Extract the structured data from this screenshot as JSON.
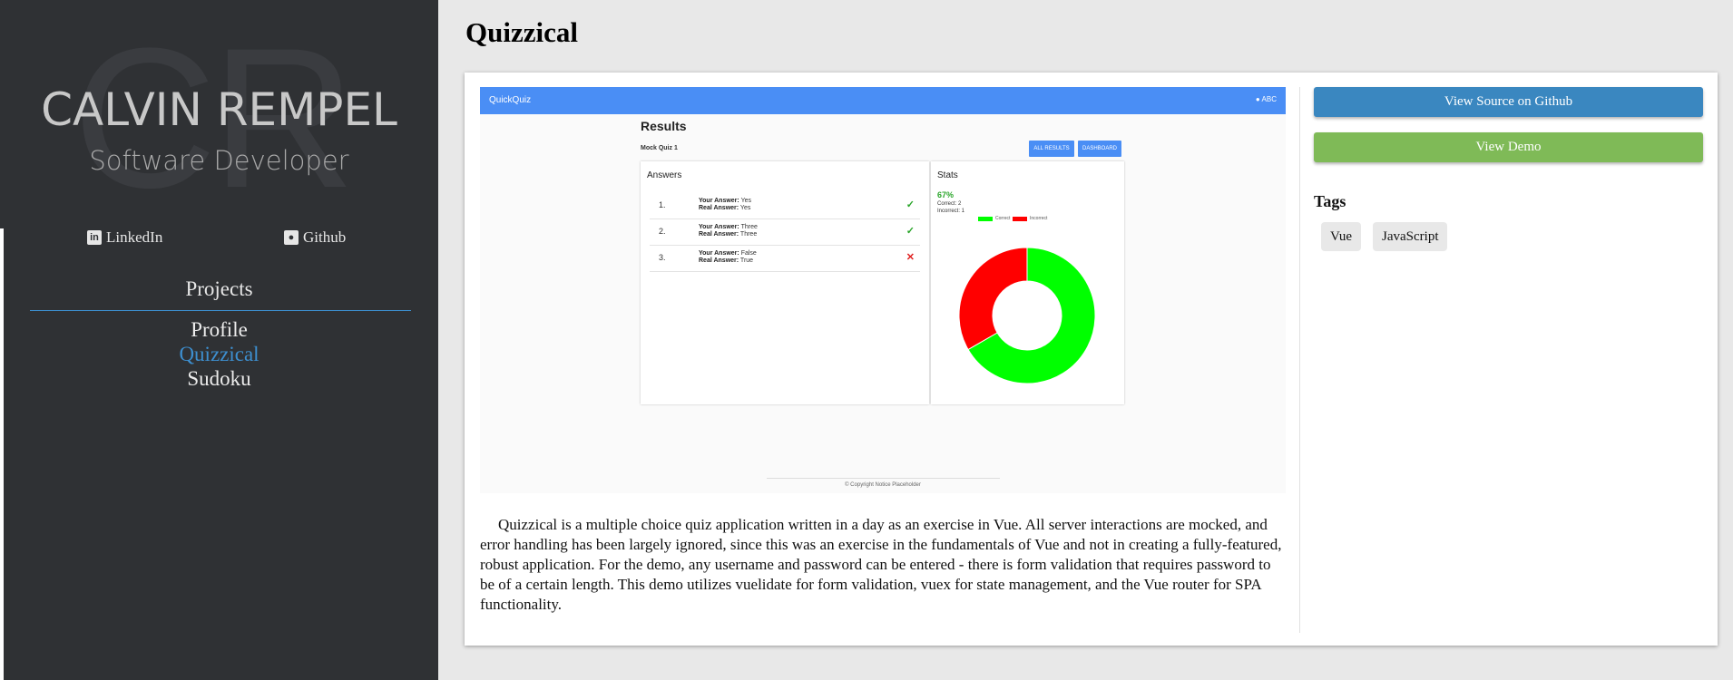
{
  "sidebar": {
    "monogram": "CR",
    "name": "CALVIN REMPEL",
    "role": "Software Developer",
    "links": [
      {
        "label": "LinkedIn",
        "icon": "linkedin-icon"
      },
      {
        "label": "Github",
        "icon": "github-icon"
      }
    ],
    "projects_heading": "Projects",
    "nav": [
      {
        "label": "Profile",
        "active": false
      },
      {
        "label": "Quizzical",
        "active": true
      },
      {
        "label": "Sudoku",
        "active": false
      }
    ]
  },
  "main": {
    "title": "Quizzical",
    "description": "Quizzical is a multiple choice quiz application written in a day as an exercise in Vue. All server interactions are mocked, and error handling has been largely ignored, since this was an exercise in the fundamentals of Vue and not in creating a fully-featured, robust application. For the demo, any username and password can be entered - there is form validation that requires password to be of a certain length. This demo utilizes vuelidate for form validation, vuex for state management, and the Vue router for SPA functionality.",
    "buttons": {
      "source": "View Source on Github",
      "demo": "View Demo"
    },
    "tags_heading": "Tags",
    "tags": [
      "Vue",
      "JavaScript"
    ]
  },
  "screenshot": {
    "app_name": "QuickQuiz",
    "user": "ABC",
    "heading": "Results",
    "quiz_name": "Mock Quiz 1",
    "buttons": [
      "ALL RESULTS",
      "DASHBOARD"
    ],
    "answers_title": "Answers",
    "answer_label": "Your Answer:",
    "real_label": "Real Answer:",
    "answers": [
      {
        "num": "1.",
        "your": "Yes",
        "real": "Yes",
        "correct": true
      },
      {
        "num": "2.",
        "your": "Three",
        "real": "Three",
        "correct": true
      },
      {
        "num": "3.",
        "your": "False",
        "real": "True",
        "correct": false
      }
    ],
    "stats_title": "Stats",
    "percent": "67%",
    "correct_text": "Correct: 2",
    "incorrect_text": "Incorrect: 1",
    "legend": [
      "Correct",
      "Incorrect"
    ],
    "footer": "© Copyright Notice Placeholder"
  },
  "chart_data": {
    "type": "pie",
    "categories": [
      "Correct",
      "Incorrect"
    ],
    "values": [
      2,
      1
    ],
    "donut": true,
    "colors": [
      "#00ff00",
      "#ff0000"
    ]
  },
  "colors": {
    "sidebar_bg": "#2f3134",
    "accent": "#3d8fd0",
    "source_button": "#3a87c0",
    "demo_button": "#7fba57",
    "quiz_bar": "#4a8ef5"
  }
}
